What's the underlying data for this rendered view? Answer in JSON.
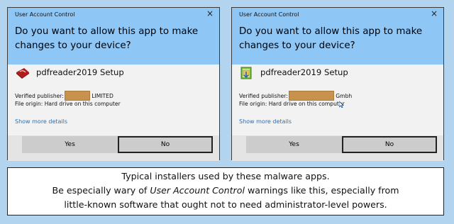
{
  "dialogs": [
    {
      "title": "User Account Control",
      "close_glyph": "×",
      "question": "Do you want to allow this app to make changes to your device?",
      "app_name": "pdfreader2019 Setup",
      "app_icon": "red-pdf-icon",
      "publisher_label": "Verified publisher:",
      "publisher_suffix": "LIMITED",
      "origin": "File origin: Hard drive on this computer",
      "more_link": "Show more details",
      "yes_label": "Yes",
      "no_label": "No"
    },
    {
      "title": "User Account Control",
      "close_glyph": "×",
      "question": "Do you want to allow this app to make changes to your device?",
      "app_name": "pdfreader2019 Setup",
      "app_icon": "installer-box-icon",
      "publisher_label": "Verified publisher:",
      "publisher_suffix": "Gmbh",
      "origin": "File origin: Hard drive on this computer",
      "more_link": "Show more details",
      "yes_label": "Yes",
      "no_label": "No"
    }
  ],
  "caption": {
    "line1": "Typical installers used by these malware apps.",
    "line2_pre": "Be especially wary of ",
    "line2_em": "User Account Control",
    "line2_post": " warnings like this, especially from",
    "line3": "little-known software that ought not to need administrator-level powers."
  },
  "colors": {
    "background": "#b3d4ef",
    "dialog_header": "#8ec6f6",
    "redaction": "#c8924c",
    "link": "#2d6fb8"
  }
}
